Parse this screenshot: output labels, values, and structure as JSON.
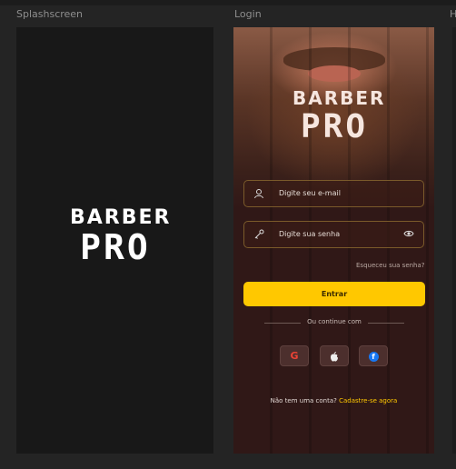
{
  "frames": {
    "splash_label": "Splashscreen",
    "login_label": "Login",
    "third_label": "H"
  },
  "splash": {
    "logo_line1": "BARBER",
    "logo_line2": "PRO"
  },
  "login": {
    "logo_line1": "BARBER",
    "logo_line2": "PRO",
    "email_placeholder": "Digite seu e-mail",
    "password_placeholder": "Digite sua senha",
    "forgot_link": "Esqueceu sua senha?",
    "enter_button": "Entrar",
    "or_continue": "Ou continue com",
    "social": {
      "google": "G",
      "apple": "",
      "facebook": "f"
    },
    "signup_text": "Não tem uma conta? ",
    "signup_link": "Cadastre-se agora"
  },
  "icons": {
    "user": "user-icon",
    "key": "key-icon",
    "eye": "eye-icon",
    "google": "google-icon",
    "apple": "apple-icon",
    "facebook": "facebook-icon"
  },
  "colors": {
    "accent": "#ffc800",
    "background": "#242424",
    "splash_bg": "#181818",
    "login_bg": "#301817"
  }
}
